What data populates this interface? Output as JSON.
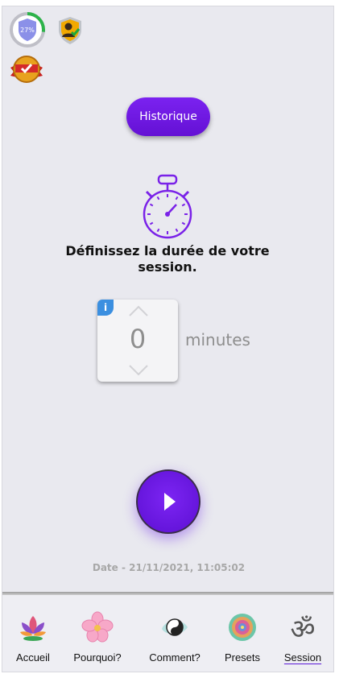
{
  "badges": {
    "progress_percent": 27,
    "progress_text": "27%",
    "shield_icon": "shield-progress-icon",
    "user_icon": "user-check-badge-icon",
    "award_icon": "award-ribbon-icon"
  },
  "header": {
    "history_button": "Historique"
  },
  "main": {
    "timer_icon": "stopwatch-icon",
    "prompt": "Définissez la durée de votre session.",
    "picker": {
      "info_label": "i",
      "value": "0",
      "unit": "minutes"
    },
    "play_icon": "play-icon",
    "date_text": "Date - 21/11/2021, 11:05:02"
  },
  "nav": {
    "items": [
      {
        "label": "Accueil",
        "icon": "lotus-icon"
      },
      {
        "label": "Pourquoi?",
        "icon": "flower-icon"
      },
      {
        "label": "Comment?",
        "icon": "yin-yang-icon"
      },
      {
        "label": "Presets",
        "icon": "mandala-icon"
      },
      {
        "label": "Session",
        "icon": "om-icon",
        "active": true
      }
    ]
  },
  "colors": {
    "accent": "#6a14e0",
    "background": "#e9e9ef",
    "info": "#3b8fe0"
  }
}
